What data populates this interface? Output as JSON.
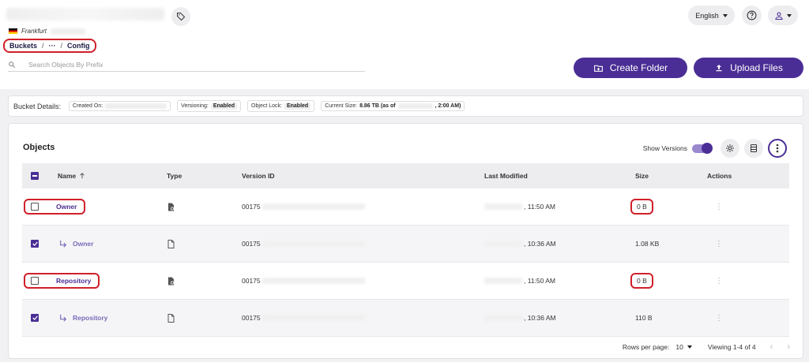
{
  "header": {
    "region": "Frankfurt",
    "breadcrumb": {
      "root": "Buckets",
      "sep1": "/",
      "middle": "···",
      "sep2": "/",
      "current": "Config"
    },
    "search": {
      "placeholder": "Search Objects By Prefix"
    },
    "language": "English",
    "create_folder": "Create Folder",
    "upload_files": "Upload Files"
  },
  "details": {
    "label": "Bucket Details:",
    "created_on_label": "Created On:",
    "versioning_label": "Versioning:",
    "versioning_value": "Enabled",
    "object_lock_label": "Object Lock:",
    "object_lock_value": "Enabled",
    "current_size_label": "Current Size:",
    "current_size_prefix": "8.86 TB (as of",
    "current_size_suffix": ", 2:00 AM)"
  },
  "objects": {
    "title": "Objects",
    "show_versions": "Show Versions",
    "columns": {
      "name": "Name",
      "type": "Type",
      "version_id": "Version ID",
      "last_modified": "Last Modified",
      "size": "Size",
      "actions": "Actions"
    },
    "rows": [
      {
        "name": "Owner",
        "version_prefix": "00175",
        "time": ", 11:50 AM",
        "size": "0 B"
      },
      {
        "name": "Owner",
        "version_prefix": "00175",
        "time": ", 10:36 AM",
        "size": "1.08 KB"
      },
      {
        "name": "Repository",
        "version_prefix": "00175",
        "time": ", 11:50 AM",
        "size": "0 B"
      },
      {
        "name": "Repository",
        "version_prefix": "00175",
        "time": ", 10:36 AM",
        "size": "110 B"
      }
    ]
  },
  "pagination": {
    "rows_per_page_label": "Rows per page:",
    "rows_per_page": "10",
    "viewing": "Viewing 1-4 of 4"
  },
  "colors": {
    "accent": "#4b2e95",
    "highlight": "#d0202a"
  },
  "icons": [
    "tag-icon",
    "search-icon",
    "help-icon",
    "user-icon",
    "folder-plus-icon",
    "upload-icon",
    "gear-icon",
    "columns-icon",
    "more-vert-icon",
    "sort-up-icon",
    "file-icon",
    "version-arrow-icon",
    "chevron-left-icon",
    "chevron-right-icon"
  ]
}
